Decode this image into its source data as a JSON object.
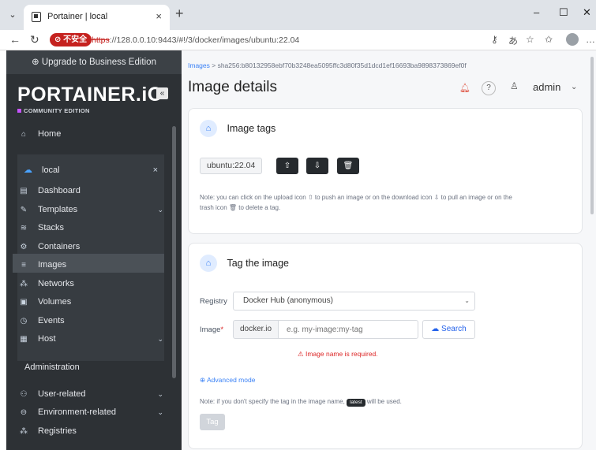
{
  "browser": {
    "tab_title": "Portainer | local",
    "insecure_label": "不安全",
    "url_protocol": "https",
    "url_rest": "://128.0.0.10:9443/#!/3/docker/images/ubuntu:22.04"
  },
  "sidebar": {
    "upgrade_label": "Upgrade to Business Edition",
    "brand": "PORTAINER.iO",
    "edition": "COMMUNITY EDITION",
    "home": "Home",
    "environment": "local",
    "env_items": [
      {
        "label": "Dashboard",
        "icon": "dashboard-icon"
      },
      {
        "label": "Templates",
        "icon": "templates-icon"
      },
      {
        "label": "Stacks",
        "icon": "stacks-icon"
      },
      {
        "label": "Containers",
        "icon": "containers-icon"
      },
      {
        "label": "Images",
        "icon": "images-icon"
      },
      {
        "label": "Networks",
        "icon": "networks-icon"
      },
      {
        "label": "Volumes",
        "icon": "volumes-icon"
      },
      {
        "label": "Events",
        "icon": "events-icon"
      },
      {
        "label": "Host",
        "icon": "host-icon"
      }
    ],
    "admin_heading": "Administration",
    "admin_items": [
      {
        "label": "User-related"
      },
      {
        "label": "Environment-related"
      },
      {
        "label": "Registries"
      }
    ]
  },
  "header": {
    "breadcrumb_link": "Images",
    "breadcrumb_current": "sha256:b80132958ebf70b3248ea5095ffc3d80f35d1dcd1ef16693ba9898373869ef0f",
    "title": "Image details",
    "username": "admin"
  },
  "image_tags": {
    "title": "Image tags",
    "tag": "ubuntu:22.04",
    "note_1": "Note: you can click on the upload icon ⇧ to push an image or on the download icon ⇩ to pull an image or on the",
    "note_2": "trash icon 🗑 to delete a tag."
  },
  "tag_image": {
    "title": "Tag the image",
    "registry_label": "Registry",
    "registry_value": "Docker Hub (anonymous)",
    "image_label": "Image",
    "image_prefix": "docker.io",
    "image_placeholder": "e.g. my-image:my-tag",
    "search_label": "Search",
    "error": "Image name is required.",
    "advanced_mode": "Advanced mode",
    "note_before": "Note: if you don't specify the tag in the image name,",
    "latest_badge": "latest",
    "note_after": "will be used.",
    "tag_button": "Tag"
  }
}
